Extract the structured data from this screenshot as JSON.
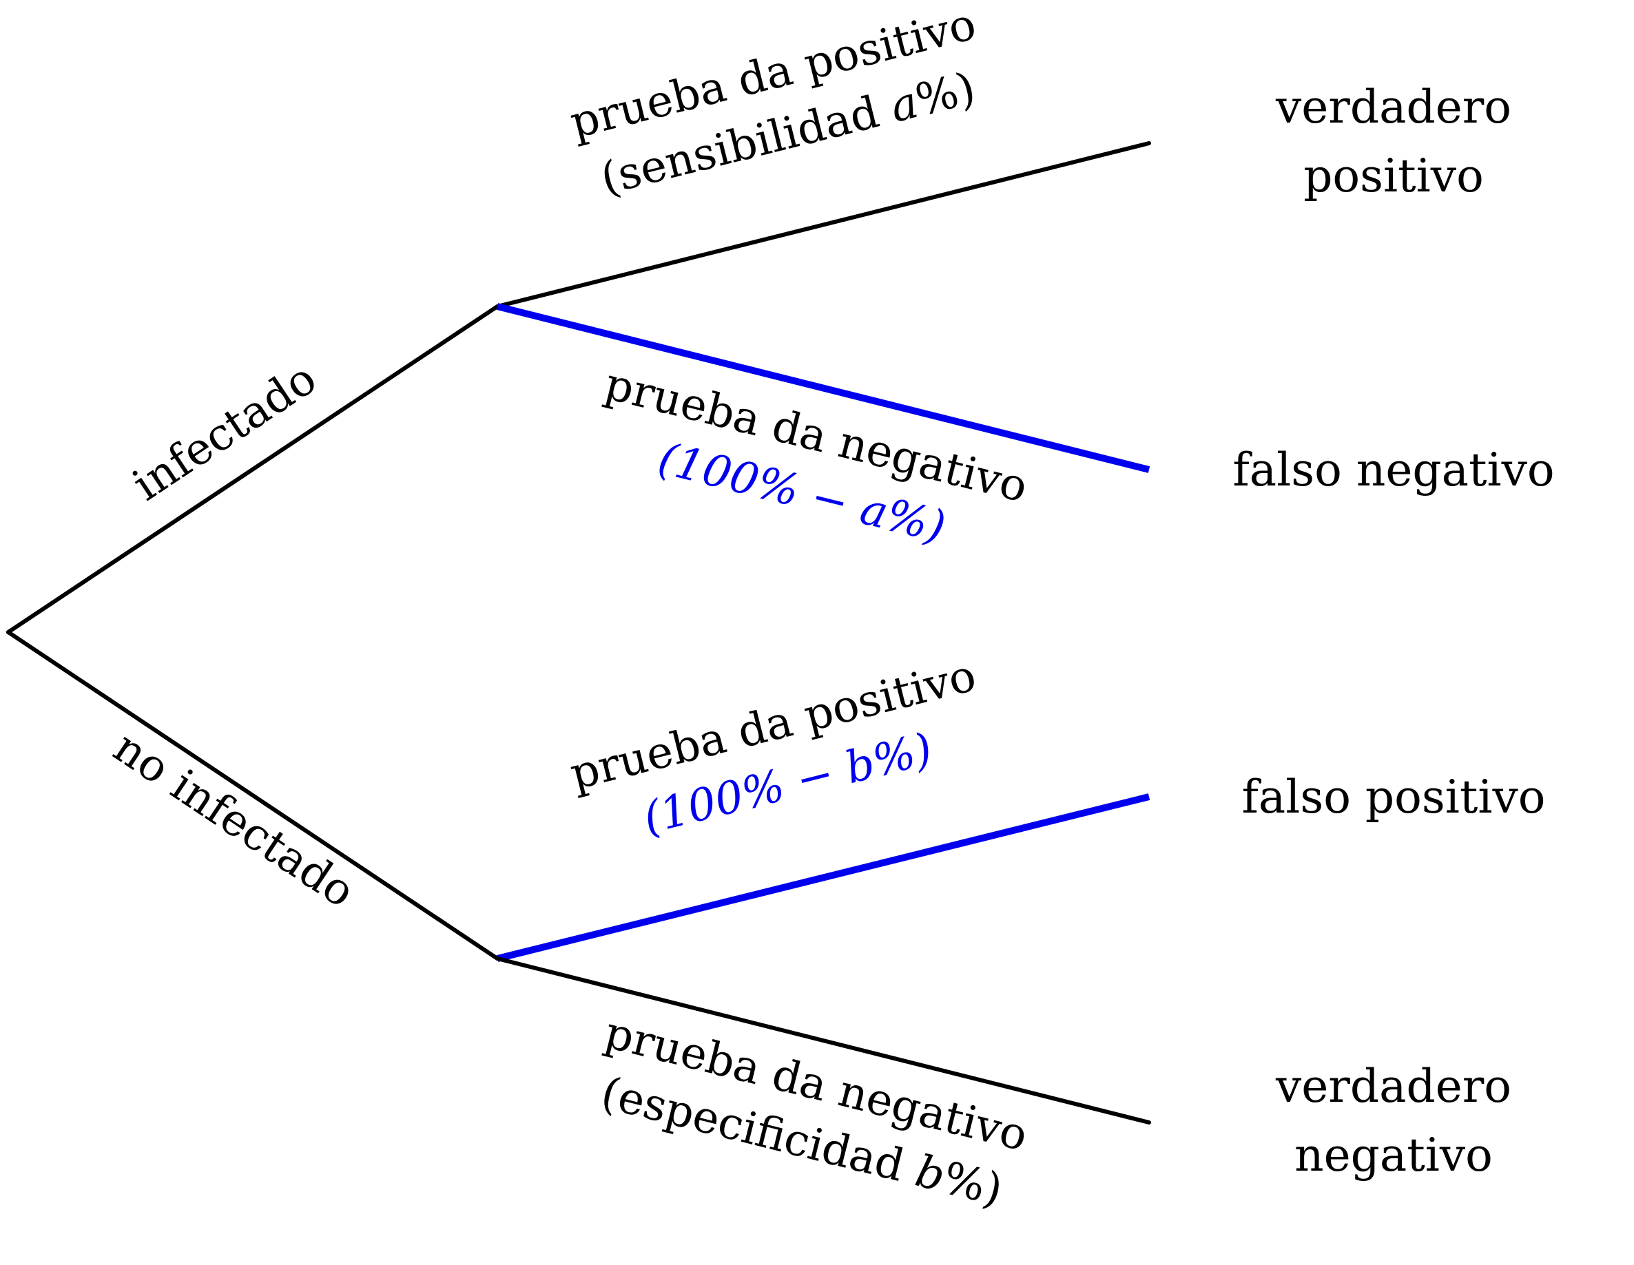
{
  "colors": {
    "branch": "#000000",
    "highlight": "#0000ee",
    "background": "#ffffff"
  },
  "branches": {
    "infected": "infectado",
    "not_infected": "no infectado"
  },
  "tests": {
    "infected_positive": {
      "line1": "prueba da positivo",
      "line2_open": "(sensibilidad ",
      "line2_var": "a",
      "line2_close": "%)"
    },
    "infected_negative": {
      "line1": "prueba da negativo",
      "line2": "(100% − a%)"
    },
    "not_infected_positive": {
      "line1": "prueba da positivo",
      "line2": "(100% − b%)"
    },
    "not_infected_negative": {
      "line1": "prueba da negativo",
      "line2_open": "(especificidad ",
      "line2_var": "b",
      "line2_close": "%)"
    }
  },
  "outcomes": {
    "true_positive": [
      "verdadero",
      "positivo"
    ],
    "false_negative": "falso negativo",
    "false_positive": "falso positivo",
    "true_negative": [
      "verdadero",
      "negativo"
    ]
  }
}
